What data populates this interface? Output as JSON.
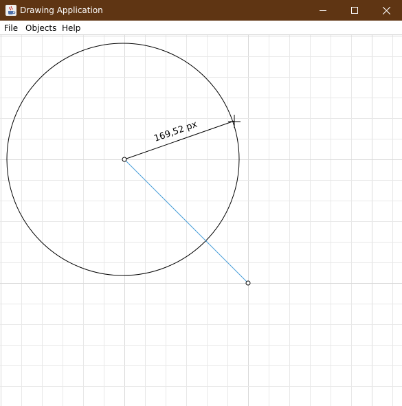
{
  "window": {
    "title": "Drawing Application",
    "icon": "java-cup-icon",
    "controls": [
      "minimize-icon",
      "maximize-icon",
      "close-icon"
    ],
    "titlebar_color": "#5f3513"
  },
  "menubar": {
    "items": [
      {
        "label": "File"
      },
      {
        "label": "Objects"
      },
      {
        "label": "Help"
      }
    ]
  },
  "canvas": {
    "grid_color": "#e8e8e8",
    "radius_label": "169,52 px",
    "shape_color": "#000000",
    "line_color": "#4a9fd9"
  }
}
